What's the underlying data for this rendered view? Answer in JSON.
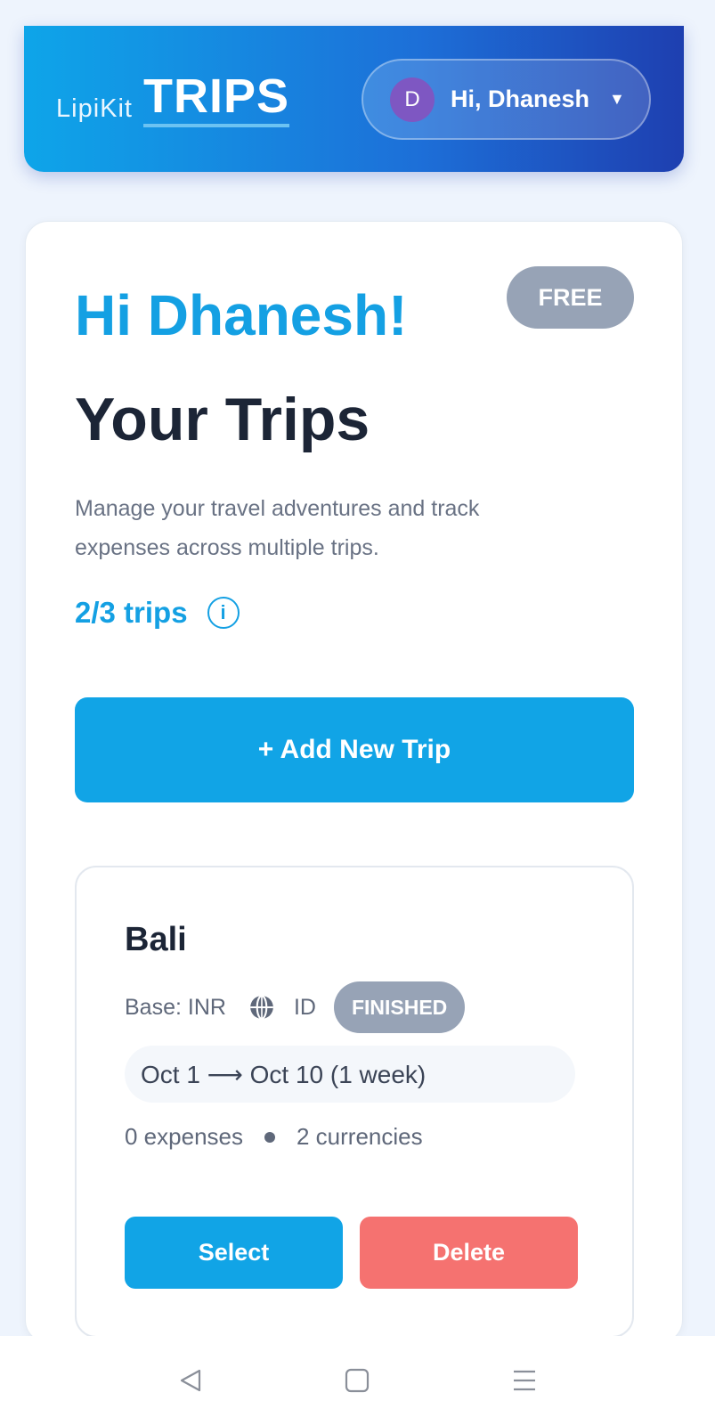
{
  "header": {
    "brand_small": "LipiKit",
    "brand_big": "TRIPS",
    "user": {
      "avatar_initial": "D",
      "greeting": "Hi, Dhanesh",
      "caret": "▼"
    }
  },
  "main": {
    "plan_badge": "FREE",
    "hello": "Hi Dhanesh!",
    "title": "Your Trips",
    "description": "Manage your travel adventures and track expenses across multiple trips.",
    "trip_count": "2/3 trips",
    "info_icon": "i",
    "add_button": "+ Add New Trip"
  },
  "trips": [
    {
      "name": "Bali",
      "base": "Base: INR",
      "country": "ID",
      "status": "FINISHED",
      "dates": "Oct 1 ⟶ Oct 10 (1 week)",
      "expenses": "0 expenses",
      "currencies": "2 currencies",
      "select_label": "Select",
      "delete_label": "Delete"
    }
  ],
  "colors": {
    "accent": "#11a4e6",
    "danger": "#f57270",
    "muted_badge": "#97a3b6",
    "header_gradient_start": "#0ea5e9",
    "header_gradient_end": "#1e3fb0"
  },
  "icons": {
    "globe": "globe-icon",
    "info": "info-icon",
    "nav_back": "back-triangle-icon",
    "nav_home": "home-square-icon",
    "nav_menu": "menu-lines-icon"
  }
}
